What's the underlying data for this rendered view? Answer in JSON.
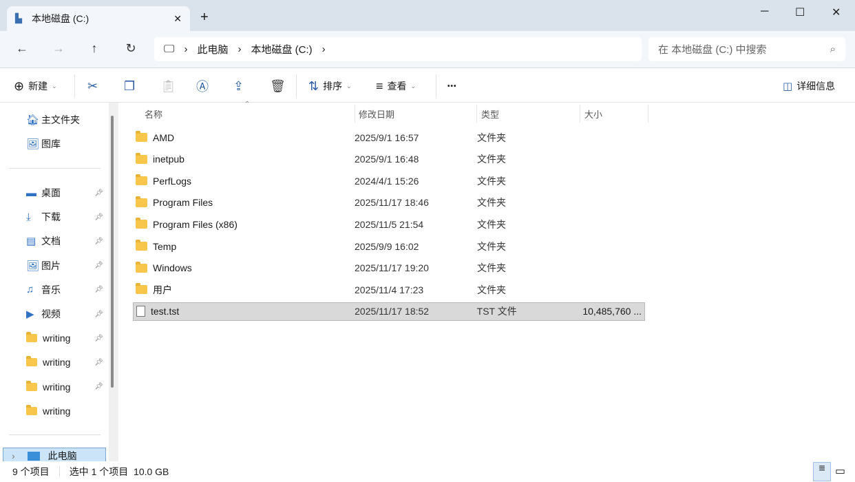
{
  "window": {
    "tab_title": "本地磁盘 (C:)",
    "new_tab": "+",
    "close_tab": "✕",
    "minimize": "─",
    "maximize": "☐",
    "close": "✕"
  },
  "address": {
    "crumbs": [
      "此电脑",
      "本地磁盘 (C:)"
    ],
    "search_placeholder": "在 本地磁盘 (C:) 中搜索"
  },
  "toolbar": {
    "new": "新建",
    "sort": "排序",
    "view": "查看",
    "more": "•••",
    "details": "详细信息"
  },
  "sidebar": {
    "top": [
      {
        "label": "主文件夹",
        "icon": "home-icon"
      },
      {
        "label": "图库",
        "icon": "gallery-icon"
      }
    ],
    "pinned": [
      {
        "label": "桌面",
        "icon": "desktop-icon"
      },
      {
        "label": "下载",
        "icon": "download-icon"
      },
      {
        "label": "文档",
        "icon": "document-icon"
      },
      {
        "label": "图片",
        "icon": "pictures-icon"
      },
      {
        "label": "音乐",
        "icon": "music-icon"
      },
      {
        "label": "视频",
        "icon": "video-icon"
      },
      {
        "label": "writing",
        "icon": "folder-icon"
      },
      {
        "label": "writing",
        "icon": "folder-icon"
      },
      {
        "label": "writing",
        "icon": "folder-icon"
      },
      {
        "label": "writing",
        "icon": "folder-icon"
      }
    ],
    "this_pc": "此电脑"
  },
  "columns": [
    "名称",
    "修改日期",
    "类型",
    "大小"
  ],
  "files": [
    {
      "name": "AMD",
      "date": "2025/9/1 16:57",
      "type": "文件夹",
      "size": "",
      "kind": "folder"
    },
    {
      "name": "inetpub",
      "date": "2025/9/1 16:48",
      "type": "文件夹",
      "size": "",
      "kind": "folder"
    },
    {
      "name": "PerfLogs",
      "date": "2024/4/1 15:26",
      "type": "文件夹",
      "size": "",
      "kind": "folder"
    },
    {
      "name": "Program Files",
      "date": "2025/11/17 18:46",
      "type": "文件夹",
      "size": "",
      "kind": "folder"
    },
    {
      "name": "Program Files (x86)",
      "date": "2025/11/5 21:54",
      "type": "文件夹",
      "size": "",
      "kind": "folder"
    },
    {
      "name": "Temp",
      "date": "2025/9/9 16:02",
      "type": "文件夹",
      "size": "",
      "kind": "folder"
    },
    {
      "name": "Windows",
      "date": "2025/11/17 19:20",
      "type": "文件夹",
      "size": "",
      "kind": "folder"
    },
    {
      "name": "用户",
      "date": "2025/11/4 17:23",
      "type": "文件夹",
      "size": "",
      "kind": "folder"
    },
    {
      "name": "test.tst",
      "date": "2025/11/17 18:52",
      "type": "TST 文件",
      "size": "10,485,760 ...",
      "kind": "file",
      "selected": true
    }
  ],
  "status": {
    "count": "9 个项目",
    "selection": "选中 1 个项目  10.0 GB"
  }
}
